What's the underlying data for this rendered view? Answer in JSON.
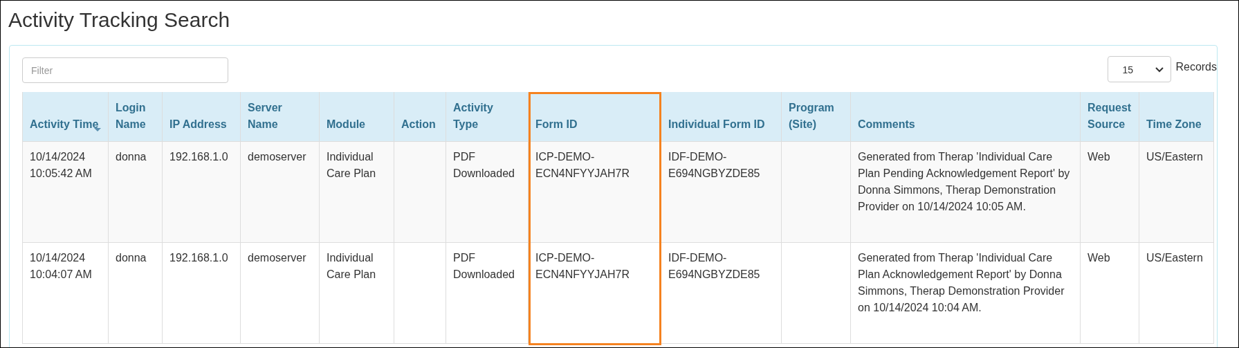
{
  "page": {
    "title": "Activity Tracking Search"
  },
  "filter": {
    "placeholder": "Filter"
  },
  "page_size": {
    "value": "15",
    "label": "Records"
  },
  "table": {
    "columns": [
      {
        "label": "Activity Time",
        "sorted_descending": true,
        "highlighted": false
      },
      {
        "label": "Login Name",
        "sorted_descending": false,
        "highlighted": false
      },
      {
        "label": "IP Address",
        "sorted_descending": false,
        "highlighted": false
      },
      {
        "label": "Server Name",
        "sorted_descending": false,
        "highlighted": false
      },
      {
        "label": "Module",
        "sorted_descending": false,
        "highlighted": false
      },
      {
        "label": "Action",
        "sorted_descending": false,
        "highlighted": false
      },
      {
        "label": "Activity Type",
        "sorted_descending": false,
        "highlighted": false
      },
      {
        "label": "Form ID",
        "sorted_descending": false,
        "highlighted": true
      },
      {
        "label": "Individual Form ID",
        "sorted_descending": false,
        "highlighted": false
      },
      {
        "label": "Program (Site)",
        "sorted_descending": false,
        "highlighted": false
      },
      {
        "label": "Comments",
        "sorted_descending": false,
        "highlighted": false
      },
      {
        "label": "Request Source",
        "sorted_descending": false,
        "highlighted": false
      },
      {
        "label": "Time Zone",
        "sorted_descending": false,
        "highlighted": false
      }
    ],
    "rows": [
      [
        "10/14/2024 10:05:42 AM",
        "donna",
        "192.168.1.0",
        "demoserver",
        "Individual Care Plan",
        "",
        "PDF Downloaded",
        "ICP-DEMO-ECN4NFYYJAH7R",
        "IDF-DEMO-E694NGBYZDE85",
        "",
        "Generated from Therap 'Individual Care Plan Pending Acknowledgement Report' by Donna Simmons, Therap Demonstration Provider on 10/14/2024 10:05 AM.",
        "Web",
        "US/Eastern"
      ],
      [
        "10/14/2024 10:04:07 AM",
        "donna",
        "192.168.1.0",
        "demoserver",
        "Individual Care Plan",
        "",
        "PDF Downloaded",
        "ICP-DEMO-ECN4NFYYJAH7R",
        "IDF-DEMO-E694NGBYZDE85",
        "",
        "Generated from Therap 'Individual Care Plan Acknowledgement Report' by Donna Simmons, Therap Demonstration Provider on 10/14/2024 10:04 AM.",
        "Web",
        "US/Eastern"
      ]
    ]
  }
}
